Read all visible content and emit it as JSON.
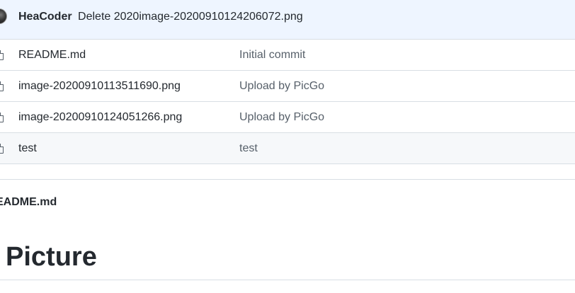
{
  "commit": {
    "author": "HeaCoder",
    "message": "Delete 2020image-20200910124206072.png"
  },
  "files": [
    {
      "name": "README.md",
      "commit_message": "Initial commit",
      "icon": "file-icon"
    },
    {
      "name": "image-20200910113511690.png",
      "commit_message": "Upload by PicGo",
      "icon": "file-icon"
    },
    {
      "name": "image-20200910124051266.png",
      "commit_message": "Upload by PicGo",
      "icon": "file-icon"
    },
    {
      "name": "test",
      "commit_message": "test",
      "icon": "file-icon"
    }
  ],
  "readme": {
    "title": "EADME.md",
    "heading": "Picture"
  }
}
